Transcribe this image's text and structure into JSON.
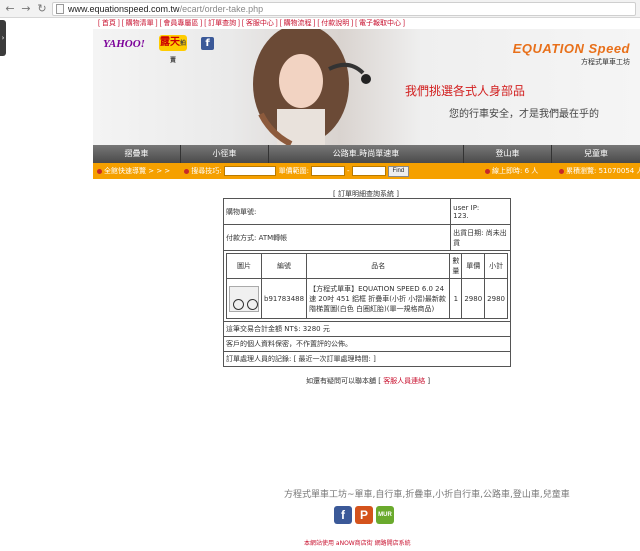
{
  "browser": {
    "url_host": "www.equationspeed.com.tw",
    "url_path": "/ecart/order-take.php"
  },
  "toplinks": [
    "首頁",
    "購物清單",
    "會員專屬區",
    "訂單查詢",
    "客服中心",
    "購物流程",
    "付款說明",
    "電子報取中心"
  ],
  "banner": {
    "logo_yahoo": "YAHOO!",
    "logo_ruten": "露天",
    "logo_ruten_sub": "拍賣",
    "fb": "f",
    "brand_name": "EQUATION Speed",
    "brand_sub": "方程式單車工坊",
    "slogan1": "我們挑選各式人身部品",
    "slogan2": "您的行車安全，才是我們最在乎的"
  },
  "mainnav": [
    "摺疊車",
    "小徑車",
    "公路車.時尚單速車",
    "登山車",
    "兒童車"
  ],
  "searchbar": {
    "quick": "全館快速導覽 > > >",
    "keyword_label": "搜尋技巧:",
    "price_label": "單價範圍:",
    "find": "Find",
    "online_label": "線上即時:",
    "online_value": "6 人",
    "count_label": "累積瀏覽:",
    "count_value": "51070054 人"
  },
  "order": {
    "title": "訂單明細查詢系統",
    "order_no_label": "購物單號:",
    "user_ip": "user IP:",
    "user_ip_value": "123.",
    "payment_label": "付款方式:",
    "payment_value": "ATM轉帳",
    "ship_label": "出貨日期:",
    "ship_value": "尚未出貨",
    "columns": [
      "圖片",
      "編號",
      "品名",
      "數量",
      "單價",
      "小計"
    ],
    "item": {
      "code": "b91783488",
      "name": "【方程式單車】EQUATION SPEED 6.0 24速 20吋 451 鋁框 折疊車(小折 小摺)最新款階梯置圖(白色 白圈紅胎)(單一規格商品)",
      "qty": "1",
      "price": "2980",
      "subtotal": "2980"
    },
    "total_label": "這筆交易合計金額 NT$:",
    "total_value": "3280 元",
    "privacy": "客戶的個人資料保密，不作置評的公佈。",
    "handler": "訂單處理人員的記錄: [ 最近一次訂單處理時間: ]"
  },
  "contact": {
    "text": "如還有疑問可以聯本舖",
    "link": "客服人員連絡"
  },
  "footer": {
    "line": "方程式單車工坊~單車,自行車,折疊車,小折自行車,公路車,登山車,兒童車",
    "icons": [
      "f",
      "P",
      "MUR"
    ],
    "powered": "本網站使用 aNOW商店街 網路開店系統"
  }
}
